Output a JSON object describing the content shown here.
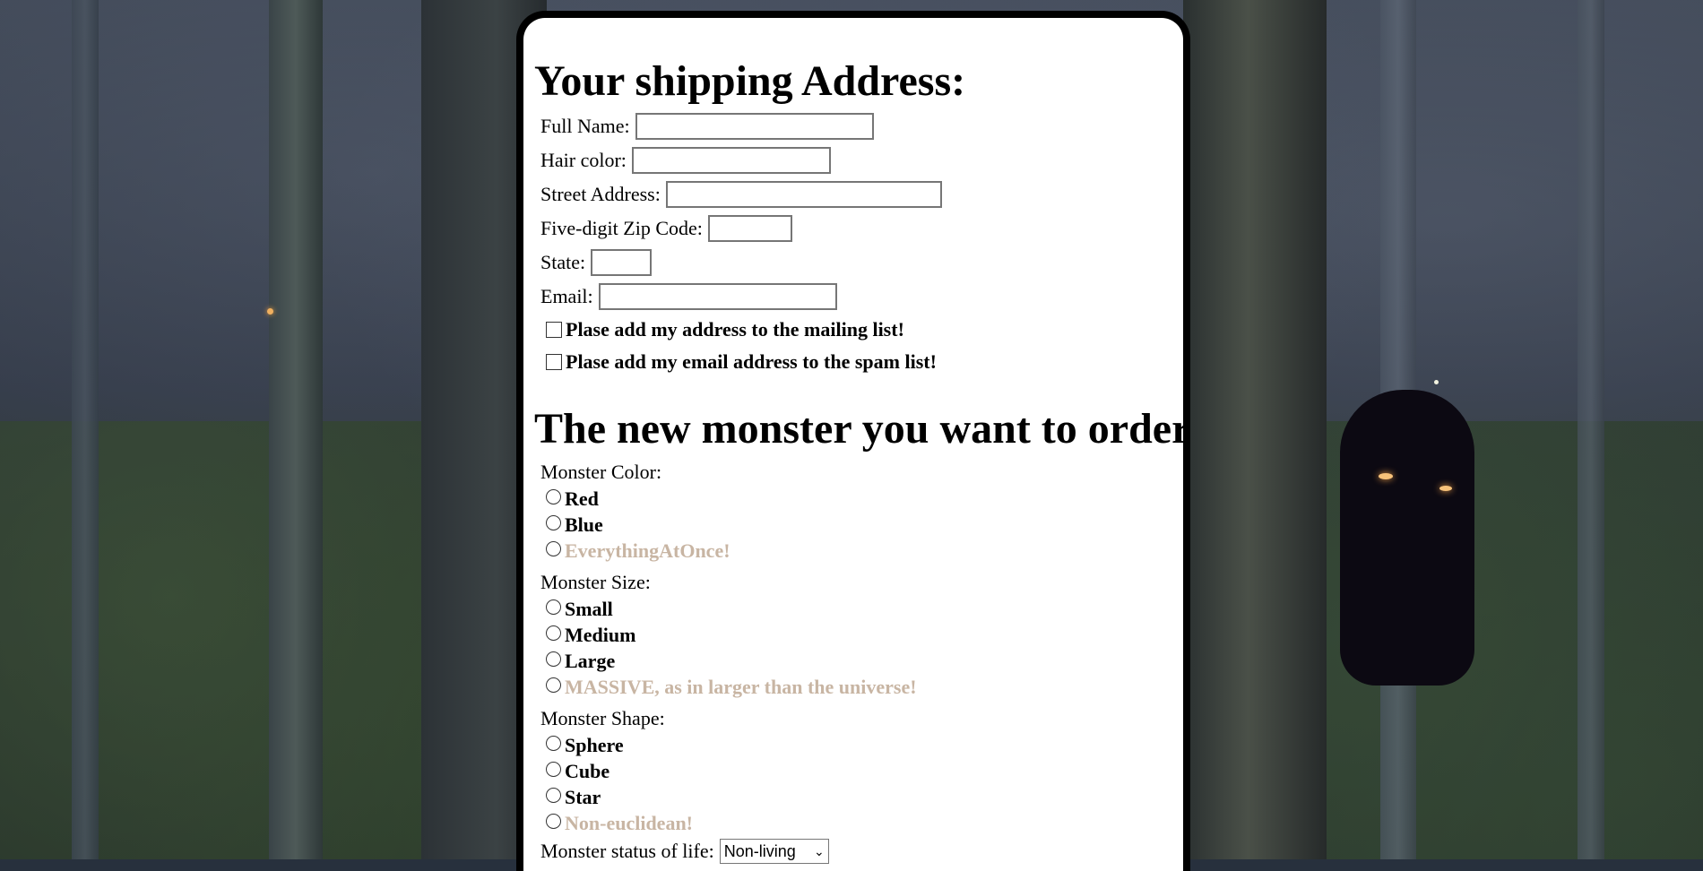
{
  "shipping": {
    "heading": "Your shipping Address:",
    "fields": [
      {
        "label": "Full Name:",
        "value": ""
      },
      {
        "label": "Hair color:",
        "value": ""
      },
      {
        "label": "Street Address:",
        "value": ""
      },
      {
        "label": "Five-digit Zip Code:",
        "value": ""
      },
      {
        "label": "State:",
        "value": ""
      },
      {
        "label": "Email:",
        "value": ""
      }
    ],
    "checkboxes": [
      {
        "label": "Plase add my address to the mailing list!",
        "checked": false
      },
      {
        "label": "Plase add my email address to the spam list!",
        "checked": false
      }
    ]
  },
  "order": {
    "heading": "The new monster you want to order:",
    "color": {
      "label": "Monster Color:",
      "options": [
        "Red",
        "Blue",
        "EverythingAtOnce!"
      ]
    },
    "size": {
      "label": "Monster Size:",
      "options": [
        "Small",
        "Medium",
        "Large",
        "MASSIVE, as in larger than the universe!"
      ]
    },
    "shape": {
      "label": "Monster Shape:",
      "options": [
        "Sphere",
        "Cube",
        "Star",
        "Non-euclidean!"
      ]
    },
    "status": {
      "label": "Monster status of life:",
      "selected": "Non-living"
    }
  },
  "colors": {
    "disabled_text": "#c8b5a3",
    "card_border": "#000000"
  }
}
